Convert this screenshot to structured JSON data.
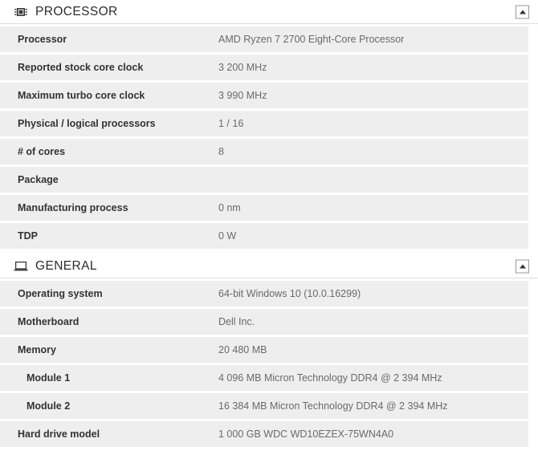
{
  "colors": {
    "row_background": "#eeeeee",
    "page_background": "#ffffff",
    "label_text": "#333333",
    "value_text": "#6a6a6a",
    "divider": "#dddddd"
  },
  "sections": [
    {
      "id": "processor",
      "title": "PROCESSOR",
      "icon": "cpu-chip-icon",
      "collapse_icon": "collapse-up-icon",
      "rows": [
        {
          "label": "Processor",
          "value": "AMD Ryzen 7 2700 Eight-Core Processor",
          "indent": false
        },
        {
          "label": "Reported stock core clock",
          "value": "3 200 MHz",
          "indent": false
        },
        {
          "label": "Maximum turbo core clock",
          "value": "3 990 MHz",
          "indent": false
        },
        {
          "label": "Physical / logical processors",
          "value": "1 / 16",
          "indent": false
        },
        {
          "label": "# of cores",
          "value": "8",
          "indent": false
        },
        {
          "label": "Package",
          "value": "",
          "indent": false
        },
        {
          "label": "Manufacturing process",
          "value": "0 nm",
          "indent": false
        },
        {
          "label": "TDP",
          "value": "0 W",
          "indent": false
        }
      ]
    },
    {
      "id": "general",
      "title": "GENERAL",
      "icon": "laptop-icon",
      "collapse_icon": "collapse-up-icon",
      "rows": [
        {
          "label": "Operating system",
          "value": "64-bit Windows 10 (10.0.16299)",
          "indent": false
        },
        {
          "label": "Motherboard",
          "value": "Dell Inc.",
          "indent": false
        },
        {
          "label": "Memory",
          "value": "20 480 MB",
          "indent": false
        },
        {
          "label": "Module 1",
          "value": "4 096 MB Micron Technology DDR4 @ 2 394 MHz",
          "indent": true
        },
        {
          "label": "Module 2",
          "value": "16 384 MB Micron Technology DDR4 @ 2 394 MHz",
          "indent": true
        },
        {
          "label": "Hard drive model",
          "value": "1 000 GB WDC WD10EZEX-75WN4A0",
          "indent": false
        }
      ]
    }
  ]
}
